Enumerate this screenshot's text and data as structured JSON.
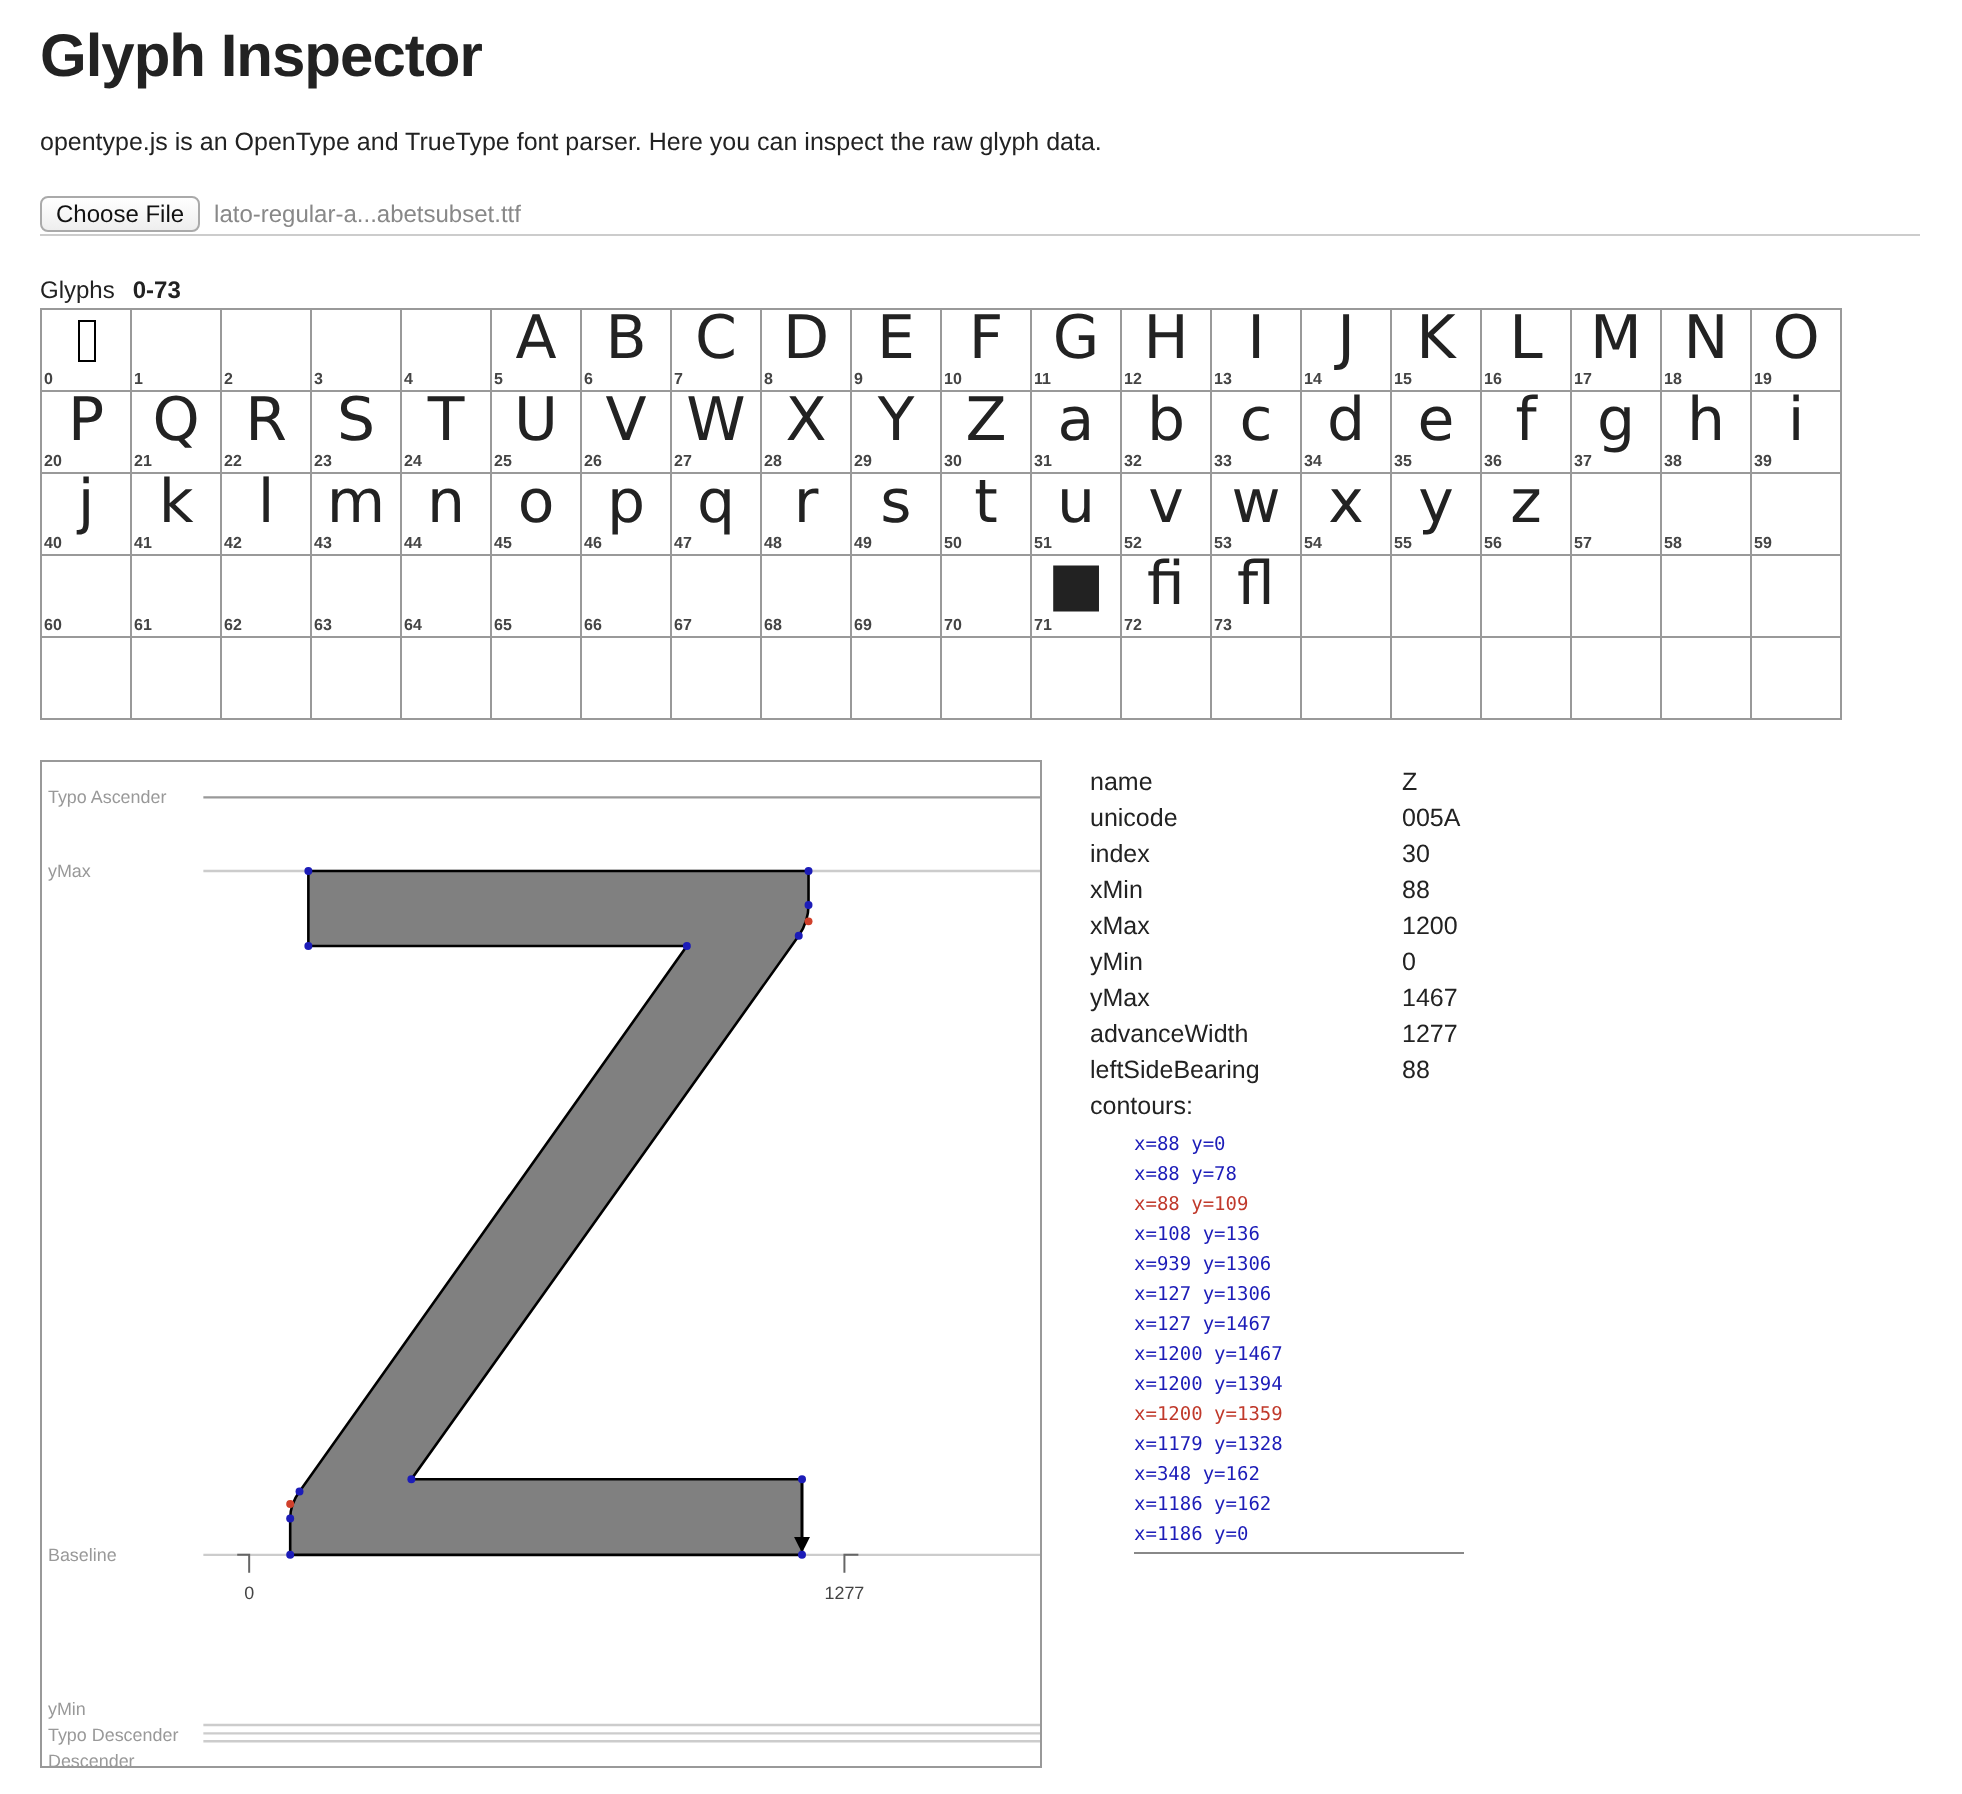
{
  "title": "Glyph Inspector",
  "description": "opentype.js is an OpenType and TrueType font parser. Here you can inspect the raw glyph data.",
  "file_input": {
    "button": "Choose File",
    "filename": "lato-regular-a...abetsubset.ttf"
  },
  "glyphs_heading": {
    "label": "Glyphs",
    "range": "0-73"
  },
  "glyphs": [
    {
      "index": "0",
      "kind": "notdef"
    },
    {
      "index": "1",
      "kind": "blank"
    },
    {
      "index": "2",
      "kind": "blank"
    },
    {
      "index": "3",
      "kind": "blank"
    },
    {
      "index": "4",
      "kind": "blank"
    },
    {
      "index": "5",
      "kind": "char",
      "char": "A"
    },
    {
      "index": "6",
      "kind": "char",
      "char": "B"
    },
    {
      "index": "7",
      "kind": "char",
      "char": "C"
    },
    {
      "index": "8",
      "kind": "char",
      "char": "D"
    },
    {
      "index": "9",
      "kind": "char",
      "char": "E"
    },
    {
      "index": "10",
      "kind": "char",
      "char": "F"
    },
    {
      "index": "11",
      "kind": "char",
      "char": "G"
    },
    {
      "index": "12",
      "kind": "char",
      "char": "H"
    },
    {
      "index": "13",
      "kind": "char",
      "char": "I"
    },
    {
      "index": "14",
      "kind": "char",
      "char": "J"
    },
    {
      "index": "15",
      "kind": "char",
      "char": "K"
    },
    {
      "index": "16",
      "kind": "char",
      "char": "L"
    },
    {
      "index": "17",
      "kind": "char",
      "char": "M"
    },
    {
      "index": "18",
      "kind": "char",
      "char": "N"
    },
    {
      "index": "19",
      "kind": "char",
      "char": "O"
    },
    {
      "index": "20",
      "kind": "char",
      "char": "P"
    },
    {
      "index": "21",
      "kind": "char",
      "char": "Q"
    },
    {
      "index": "22",
      "kind": "char",
      "char": "R"
    },
    {
      "index": "23",
      "kind": "char",
      "char": "S"
    },
    {
      "index": "24",
      "kind": "char",
      "char": "T"
    },
    {
      "index": "25",
      "kind": "char",
      "char": "U"
    },
    {
      "index": "26",
      "kind": "char",
      "char": "V"
    },
    {
      "index": "27",
      "kind": "char",
      "char": "W"
    },
    {
      "index": "28",
      "kind": "char",
      "char": "X"
    },
    {
      "index": "29",
      "kind": "char",
      "char": "Y"
    },
    {
      "index": "30",
      "kind": "char",
      "char": "Z"
    },
    {
      "index": "31",
      "kind": "char",
      "char": "a"
    },
    {
      "index": "32",
      "kind": "char",
      "char": "b"
    },
    {
      "index": "33",
      "kind": "char",
      "char": "c"
    },
    {
      "index": "34",
      "kind": "char",
      "char": "d"
    },
    {
      "index": "35",
      "kind": "char",
      "char": "e"
    },
    {
      "index": "36",
      "kind": "char",
      "char": "f"
    },
    {
      "index": "37",
      "kind": "char",
      "char": "g"
    },
    {
      "index": "38",
      "kind": "char",
      "char": "h"
    },
    {
      "index": "39",
      "kind": "char",
      "char": "i"
    },
    {
      "index": "40",
      "kind": "char",
      "char": "j"
    },
    {
      "index": "41",
      "kind": "char",
      "char": "k"
    },
    {
      "index": "42",
      "kind": "char",
      "char": "l"
    },
    {
      "index": "43",
      "kind": "char",
      "char": "m"
    },
    {
      "index": "44",
      "kind": "char",
      "char": "n"
    },
    {
      "index": "45",
      "kind": "char",
      "char": "o"
    },
    {
      "index": "46",
      "kind": "char",
      "char": "p"
    },
    {
      "index": "47",
      "kind": "char",
      "char": "q"
    },
    {
      "index": "48",
      "kind": "char",
      "char": "r"
    },
    {
      "index": "49",
      "kind": "char",
      "char": "s"
    },
    {
      "index": "50",
      "kind": "char",
      "char": "t"
    },
    {
      "index": "51",
      "kind": "char",
      "char": "u"
    },
    {
      "index": "52",
      "kind": "char",
      "char": "v"
    },
    {
      "index": "53",
      "kind": "char",
      "char": "w"
    },
    {
      "index": "54",
      "kind": "char",
      "char": "x"
    },
    {
      "index": "55",
      "kind": "char",
      "char": "y"
    },
    {
      "index": "56",
      "kind": "char",
      "char": "z"
    },
    {
      "index": "57",
      "kind": "blank"
    },
    {
      "index": "58",
      "kind": "blank"
    },
    {
      "index": "59",
      "kind": "blank"
    },
    {
      "index": "60",
      "kind": "blank"
    },
    {
      "index": "61",
      "kind": "blank"
    },
    {
      "index": "62",
      "kind": "blank"
    },
    {
      "index": "63",
      "kind": "blank"
    },
    {
      "index": "64",
      "kind": "blank"
    },
    {
      "index": "65",
      "kind": "blank"
    },
    {
      "index": "66",
      "kind": "blank"
    },
    {
      "index": "67",
      "kind": "blank"
    },
    {
      "index": "68",
      "kind": "blank"
    },
    {
      "index": "69",
      "kind": "blank"
    },
    {
      "index": "70",
      "kind": "blank"
    },
    {
      "index": "71",
      "kind": "char",
      "char": "■"
    },
    {
      "index": "72",
      "kind": "char",
      "char": "ﬁ"
    },
    {
      "index": "73",
      "kind": "char",
      "char": "ﬂ"
    }
  ],
  "glyph_view": {
    "metric_lines": [
      {
        "kind": "typo_ascender",
        "label": "Typo Ascender"
      },
      {
        "kind": "ymax",
        "label": "yMax"
      },
      {
        "kind": "baseline",
        "label": "Baseline"
      },
      {
        "kind": "ymin",
        "label": "yMin"
      },
      {
        "kind": "typo_descender",
        "label": "Typo Descender"
      },
      {
        "kind": "descender",
        "label": "Descender"
      }
    ],
    "axis_labels": [
      "0",
      "1277"
    ]
  },
  "info": [
    {
      "key": "name",
      "value": "Z"
    },
    {
      "key": "unicode",
      "value": "005A"
    },
    {
      "key": "index",
      "value": "30"
    },
    {
      "key": "xMin",
      "value": "88"
    },
    {
      "key": "xMax",
      "value": "1200"
    },
    {
      "key": "yMin",
      "value": "0"
    },
    {
      "key": "yMax",
      "value": "1467"
    },
    {
      "key": "advanceWidth",
      "value": "1277"
    },
    {
      "key": "leftSideBearing",
      "value": "88"
    }
  ],
  "contours_label": "contours:",
  "contour_points": [
    {
      "label": "x=88 y=0",
      "on_curve": true
    },
    {
      "label": "x=88 y=78",
      "on_curve": true
    },
    {
      "label": "x=88 y=109",
      "on_curve": false
    },
    {
      "label": "x=108 y=136",
      "on_curve": true
    },
    {
      "label": "x=939 y=1306",
      "on_curve": true
    },
    {
      "label": "x=127 y=1306",
      "on_curve": true
    },
    {
      "label": "x=127 y=1467",
      "on_curve": true
    },
    {
      "label": "x=1200 y=1467",
      "on_curve": true
    },
    {
      "label": "x=1200 y=1394",
      "on_curve": true
    },
    {
      "label": "x=1200 y=1359",
      "on_curve": false
    },
    {
      "label": "x=1179 y=1328",
      "on_curve": true
    },
    {
      "label": "x=348 y=162",
      "on_curve": true
    },
    {
      "label": "x=1186 y=162",
      "on_curve": true
    },
    {
      "label": "x=1186 y=0",
      "on_curve": true
    }
  ]
}
